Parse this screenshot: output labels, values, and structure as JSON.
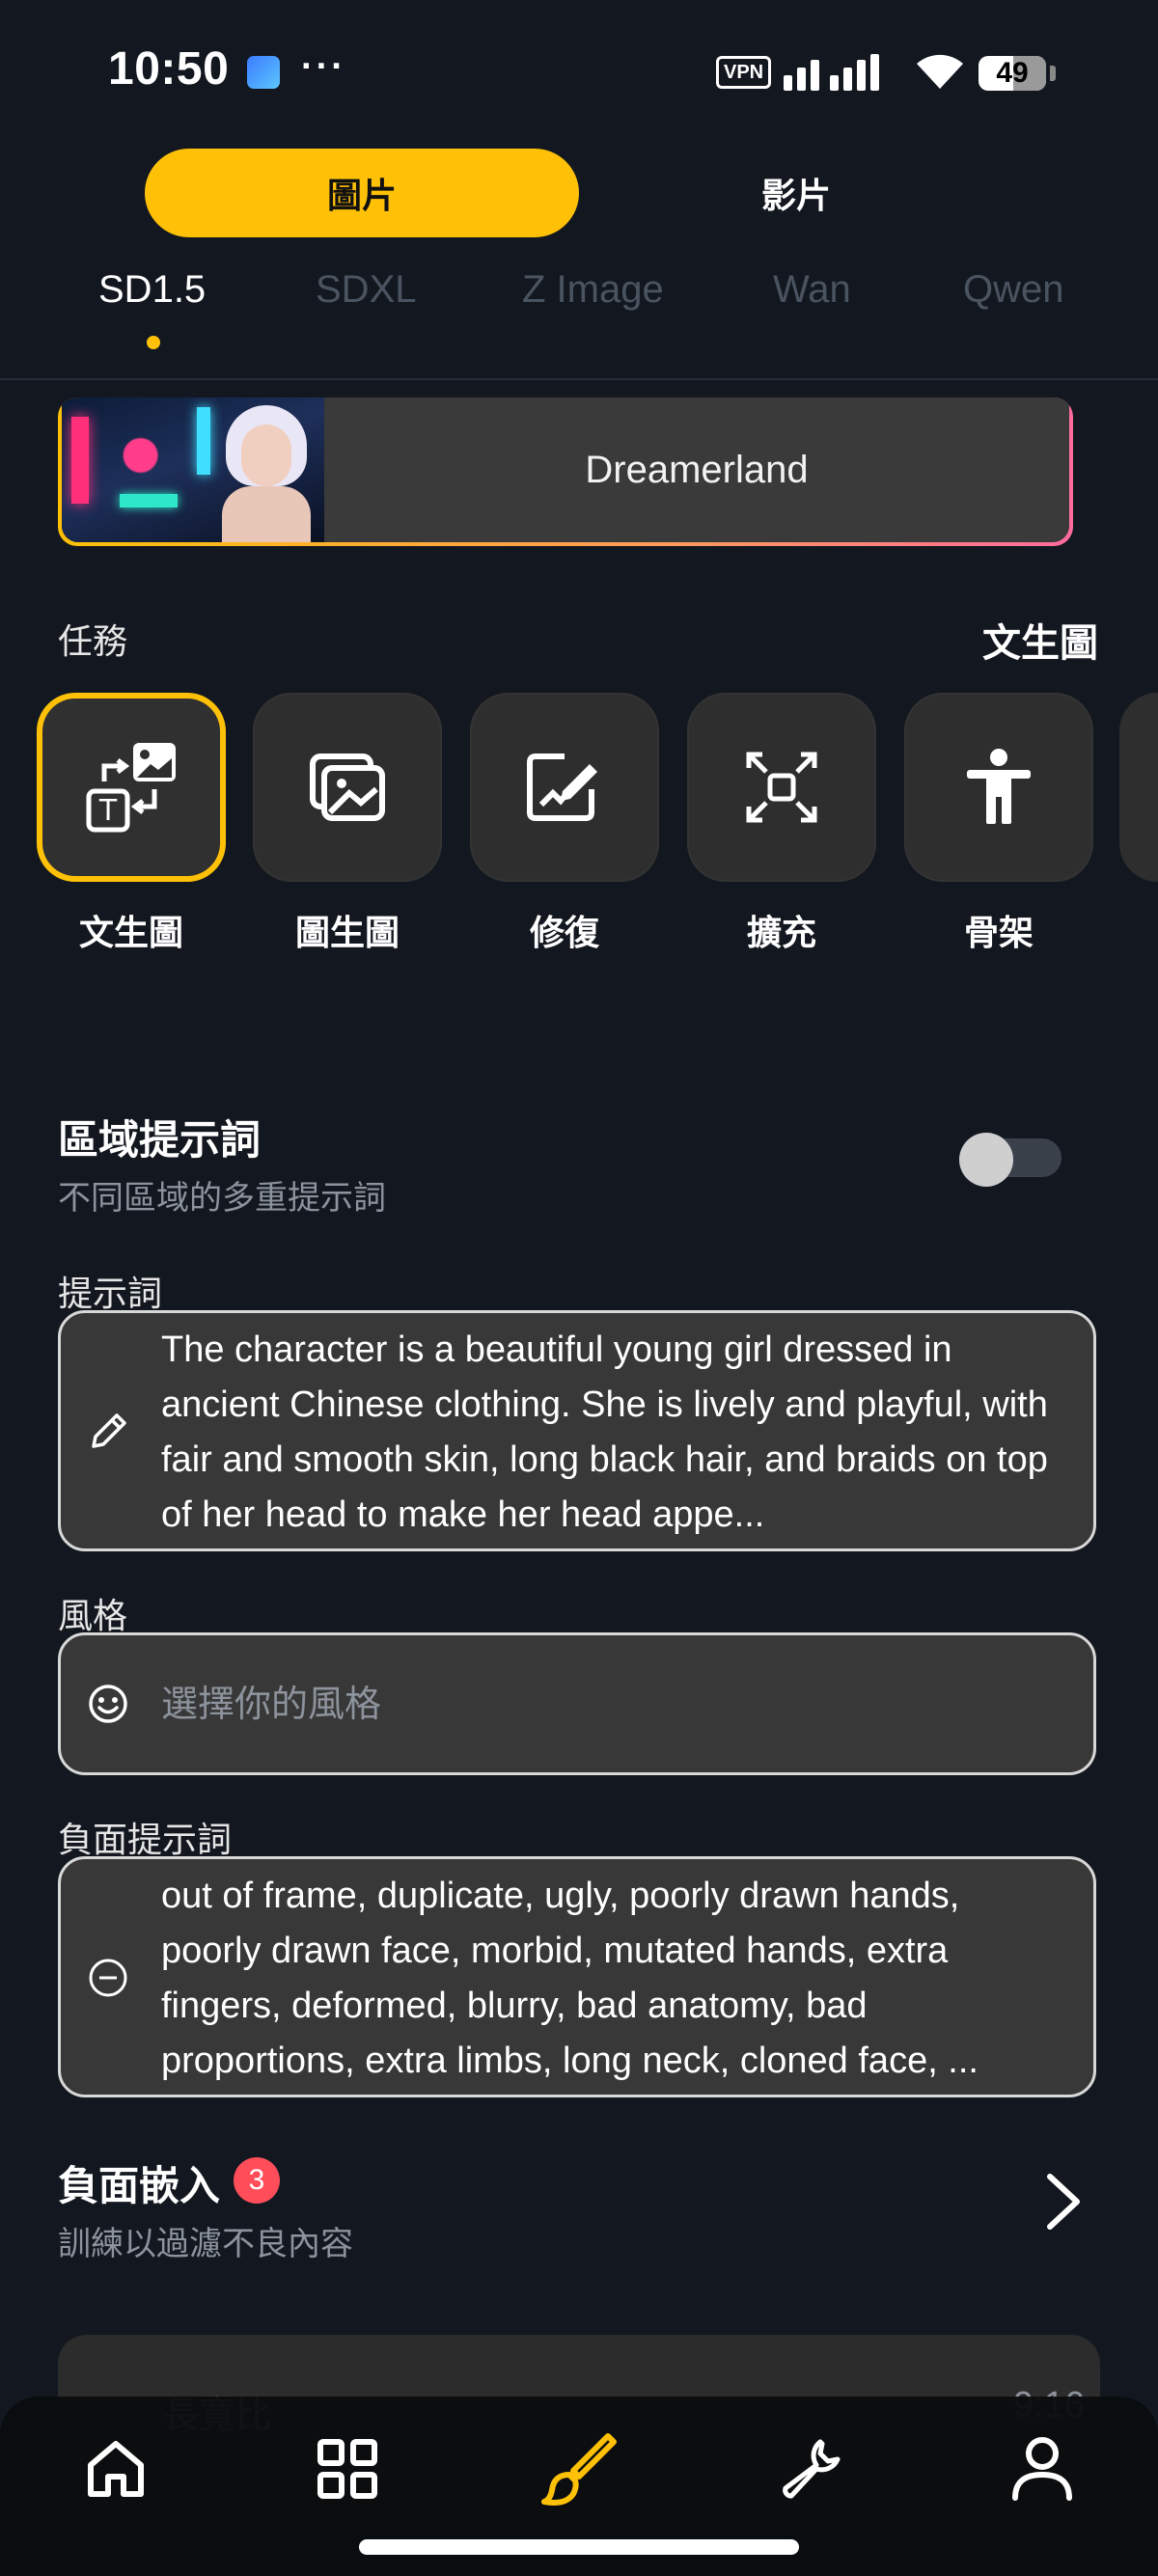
{
  "status_bar": {
    "time": "10:50",
    "more": "···",
    "vpn": "VPN",
    "battery": "49"
  },
  "mode_toggle": {
    "image": "圖片",
    "video": "影片"
  },
  "model_tabs": [
    "SD1.5",
    "SDXL",
    "Z Image",
    "Wan",
    "Qwen"
  ],
  "selected_model_tab": "SD1.5",
  "model_card": {
    "name": "Dreamerland"
  },
  "task": {
    "label": "任務",
    "selected": "文生圖",
    "items": [
      {
        "label": "文生圖",
        "icon": "text-to-image-icon"
      },
      {
        "label": "圖生圖",
        "icon": "image-to-image-icon"
      },
      {
        "label": "修復",
        "icon": "inpaint-icon"
      },
      {
        "label": "擴充",
        "icon": "outpaint-icon"
      },
      {
        "label": "骨架",
        "icon": "pose-icon"
      }
    ]
  },
  "regional_prompts": {
    "title": "區域提示詞",
    "subtitle": "不同區域的多重提示詞",
    "enabled": false
  },
  "prompt": {
    "label": "提示詞",
    "value": "The character is a beautiful young girl dressed in ancient Chinese clothing. She is lively and playful, with fair and smooth skin, long black hair, and braids on top of her head to make her head appe..."
  },
  "style": {
    "label": "風格",
    "placeholder": "選擇你的風格"
  },
  "negative_prompt": {
    "label": "負面提示詞",
    "value": "out of frame, duplicate, ugly, poorly drawn hands, poorly drawn face, morbid, mutated hands, extra fingers, deformed, blurry, bad anatomy, bad proportions, extra limbs, long neck, cloned face, ..."
  },
  "negative_embedding": {
    "title": "負面嵌入",
    "badge": "3",
    "subtitle": "訓練以過濾不良內容"
  },
  "partial_card": {
    "text": "長寬比",
    "ratio": "9:16"
  },
  "colors": {
    "accent": "#FFC107",
    "background": "#131820",
    "badge": "#FF4D5A"
  },
  "bottom_nav": [
    "home-icon",
    "grid-icon",
    "brush-icon",
    "wrench-icon",
    "profile-icon"
  ]
}
